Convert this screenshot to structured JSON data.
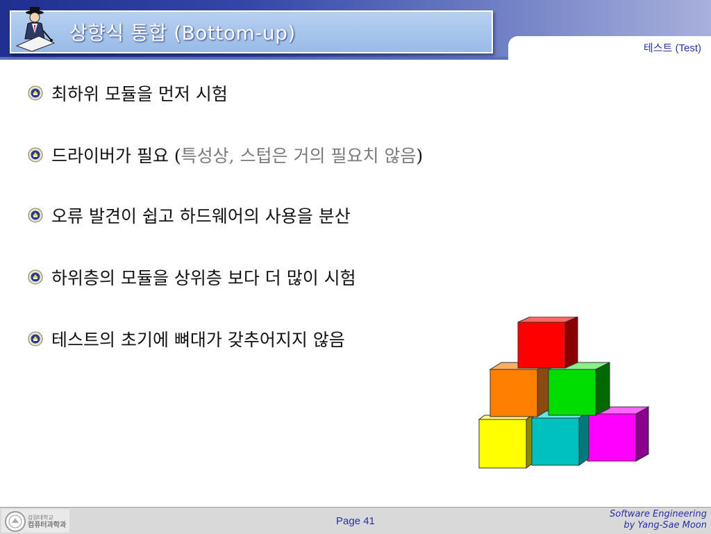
{
  "header": {
    "title": "상향식 통합 (Bottom-up)",
    "section_label": "테스트 (Test)"
  },
  "bullets": [
    {
      "text": "최하위 모듈을 먼저 시험",
      "note": "",
      "suffix": ""
    },
    {
      "text": "드라이버가 필요 (",
      "note": "특성상, 스텁은 거의 필요치 않음",
      "suffix": ")"
    },
    {
      "text": "오류 발견이 쉽고 하드웨어의 사용을 분산",
      "note": "",
      "suffix": ""
    },
    {
      "text": "하위층의 모듈을 상위층 보다 더 많이 시험",
      "note": "",
      "suffix": ""
    },
    {
      "text": "테스트의 초기에 뼈대가 갖추어지지 않음",
      "note": "",
      "suffix": ""
    }
  ],
  "illustration": {
    "icon": "stacked-blocks-icon",
    "block_colors": [
      "#ff0000",
      "#ff7f00",
      "#00dd00",
      "#ffff00",
      "#00c0c0",
      "#ff00ff"
    ]
  },
  "footer": {
    "dept_line1": "강원대학교",
    "dept_line2": "컴퓨터과학과",
    "page": "Page 41",
    "credit_line1": "Software Engineering",
    "credit_line2": "by Yang-Sae Moon"
  },
  "colors": {
    "header_dark": "#1f2f8f",
    "title_box": "#a9c6ec",
    "accent_text": "#2630a8"
  }
}
